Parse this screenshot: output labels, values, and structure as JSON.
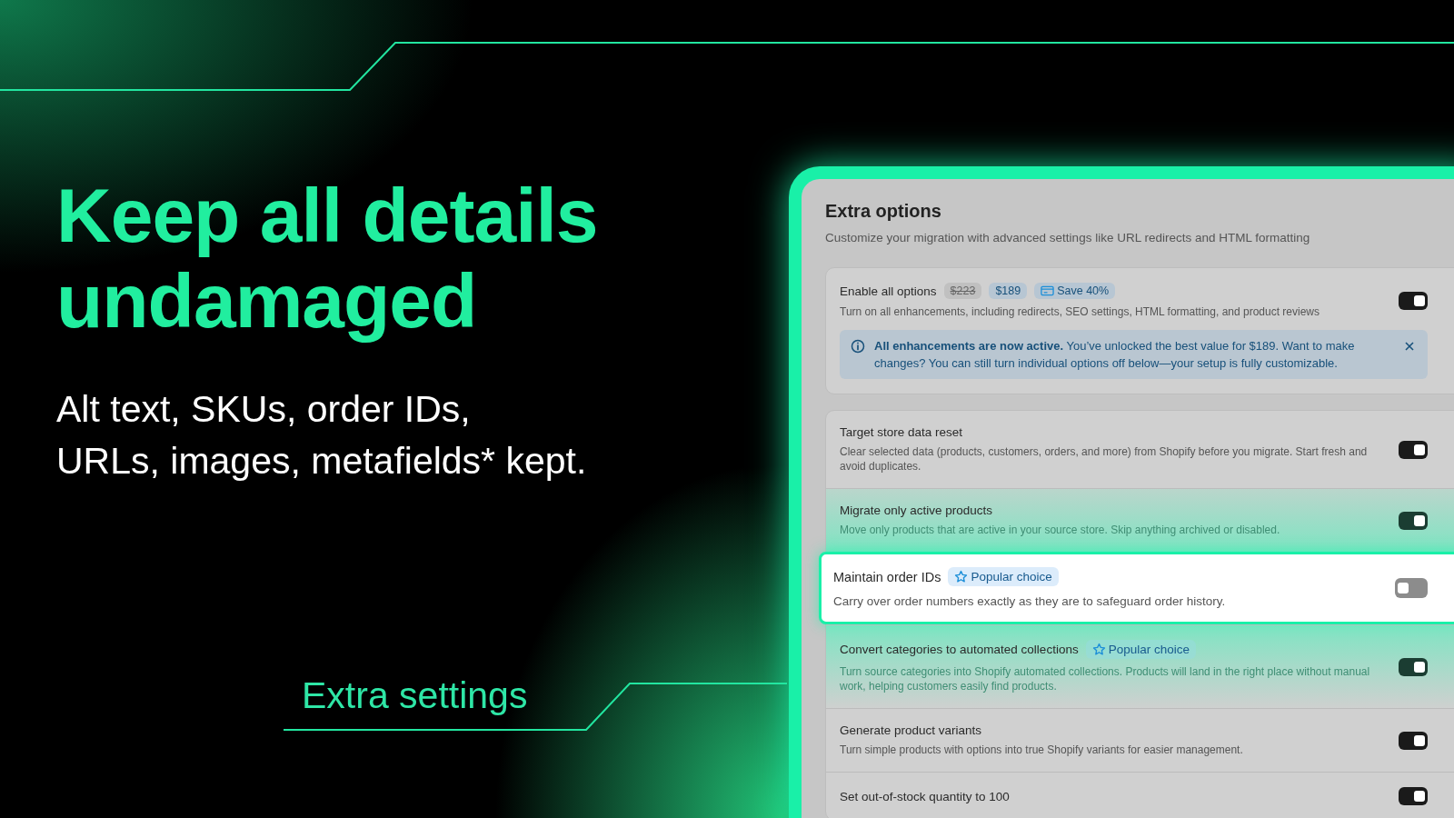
{
  "headline_lines": [
    "Keep all details",
    "undamaged"
  ],
  "subheadline_lines": [
    "Alt text, SKUs, order IDs,",
    "URLs, images, metafields* kept."
  ],
  "section_label": "Extra settings",
  "panel": {
    "title": "Extra options",
    "subtitle": "Customize your migration with advanced settings like URL redirects and HTML formatting",
    "master": {
      "title": "Enable all options",
      "badges": [
        {
          "kind": "old_price",
          "text": "$223"
        },
        {
          "kind": "price",
          "text": "$189"
        },
        {
          "kind": "save",
          "text": "Save 40%"
        }
      ],
      "description": "Turn on all enhancements, including redirects, SEO settings, HTML formatting, and product reviews",
      "on": true,
      "notice": {
        "text": "**All enhancements are now active.** You’ve unlocked the best value for $189. Want to make changes? You can still turn individual options off below—your setup is fully customizable."
      }
    },
    "options": [
      {
        "title": "Target store data reset",
        "description": "Clear selected data (products, customers, orders, and more) from Shopify before you migrate. Start fresh and avoid duplicates.",
        "on": true,
        "highlighted": false
      },
      {
        "title": "Migrate only active products",
        "description": "Move only products that are active in your source store. Skip anything archived or disabled.",
        "on": true,
        "highlighted": false
      },
      {
        "title": "Maintain order IDs",
        "badge": "Popular choice",
        "description": "Carry over order numbers exactly as they are to safeguard order history.",
        "on": false,
        "highlighted": true
      },
      {
        "title": "Convert categories to automated collections",
        "badge": "Popular choice",
        "description": "Turn source categories into Shopify automated collections. Products will land in the right place without manual work, helping customers easily find products.",
        "on": true,
        "highlighted": false
      },
      {
        "title": "Generate product variants",
        "description": "Turn simple products with options into true Shopify variants for easier management.",
        "on": true,
        "highlighted": false
      },
      {
        "title": "Set out-of-stock quantity to 100",
        "on": true,
        "highlighted": false
      }
    ]
  }
}
